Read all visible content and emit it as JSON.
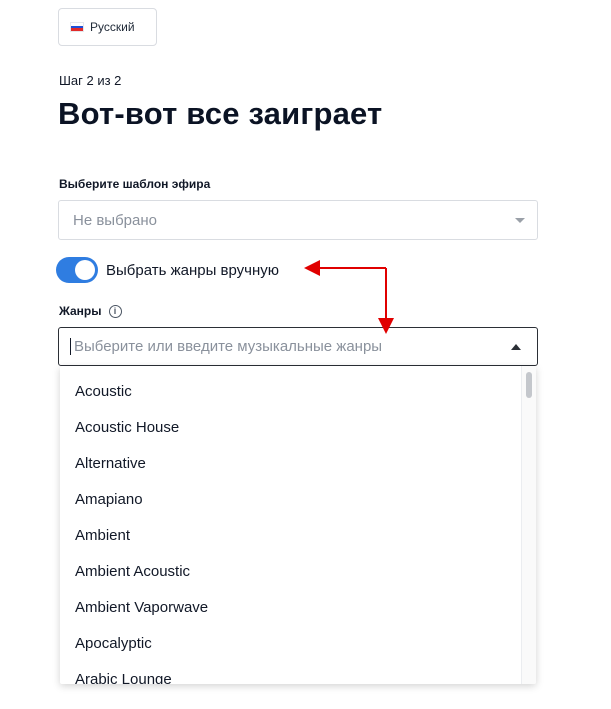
{
  "language_button": {
    "label": "Русский",
    "flag_icon": "russia-flag-icon"
  },
  "step_text": "Шаг 2 из 2",
  "page_title": "Вот-вот все заиграет",
  "template_select": {
    "label": "Выберите шаблон эфира",
    "value": "Не выбрано"
  },
  "manual_genres_toggle": {
    "label": "Выбрать жанры вручную",
    "on": true
  },
  "genres": {
    "label": "Жанры",
    "info_icon": "info-icon",
    "placeholder": "Выберите или введите музыкальные жанры",
    "options": [
      "Acoustic",
      "Acoustic House",
      "Alternative",
      "Amapiano",
      "Ambient",
      "Ambient Acoustic",
      "Ambient Vaporwave",
      "Apocalyptic",
      "Arabic Lounge"
    ]
  },
  "colors": {
    "accent": "#2f7de1",
    "annotation_arrow": "#e00000"
  }
}
